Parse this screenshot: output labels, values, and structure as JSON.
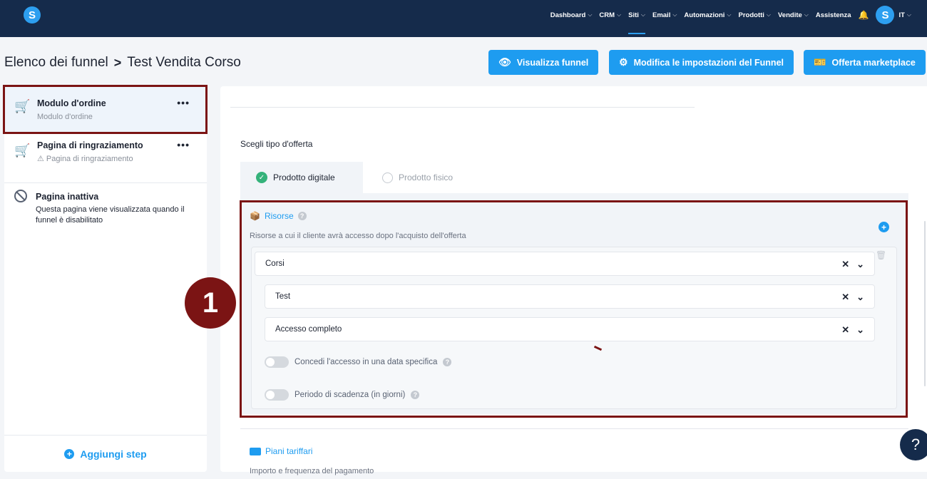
{
  "app": {
    "logo_letter": "S"
  },
  "nav": {
    "items": [
      {
        "label": "Dashboard",
        "chevron": true,
        "active": false
      },
      {
        "label": "CRM",
        "chevron": true,
        "active": false
      },
      {
        "label": "Siti",
        "chevron": true,
        "active": true
      },
      {
        "label": "Email",
        "chevron": true,
        "active": false
      },
      {
        "label": "Automazioni",
        "chevron": true,
        "active": false
      },
      {
        "label": "Prodotti",
        "chevron": true,
        "active": false
      },
      {
        "label": "Vendite",
        "chevron": true,
        "active": false
      },
      {
        "label": "Assistenza",
        "chevron": false,
        "active": false
      }
    ],
    "avatar_letter": "S",
    "language": "IT"
  },
  "breadcrumb": {
    "parent": "Elenco dei funnel",
    "separator": ">",
    "current": "Test Vendita Corso"
  },
  "actions": {
    "view_funnel": "Visualizza funnel",
    "edit_settings": "Modifica le impostazioni del Funnel",
    "marketplace": "Offerta marketplace"
  },
  "sidebar": {
    "steps": [
      {
        "title": "Modulo d'ordine",
        "subtitle": "Modulo d'ordine",
        "menu": "•••"
      },
      {
        "title": "Pagina di ringraziamento",
        "subtitle": "Pagina di ringraziamento",
        "menu": "•••"
      },
      {
        "title": "Pagina inattiva",
        "subtitle": "Questa pagina viene visualizzata quando il funnel è disabilitato"
      }
    ],
    "add_step": "Aggiungi step"
  },
  "offer": {
    "label": "Scegli tipo d'offerta",
    "tabs": [
      {
        "label": "Prodotto digitale",
        "selected": true
      },
      {
        "label": "Prodotto fisico",
        "selected": false
      }
    ]
  },
  "resources": {
    "title": "Risorse",
    "description": "Risorse a cui il cliente avrà accesso dopo l'acquisto dell'offerta",
    "selects": [
      {
        "value": "Corsi"
      },
      {
        "value": "Test"
      },
      {
        "value": "Accesso completo"
      }
    ],
    "toggles": [
      {
        "label": "Concedi l'accesso in una data specifica",
        "on": false
      },
      {
        "label": "Periodo di scadenza (in giorni)",
        "on": false
      }
    ]
  },
  "plans": {
    "title": "Piani tariffari",
    "description": "Importo e frequenza del pagamento"
  },
  "annotation": {
    "badge": "1"
  },
  "help": {
    "label": "?"
  },
  "colors": {
    "nav_bg": "#152b4b",
    "accent": "#1e9cf0",
    "annotation": "#7b1414",
    "success": "#34b27a"
  }
}
